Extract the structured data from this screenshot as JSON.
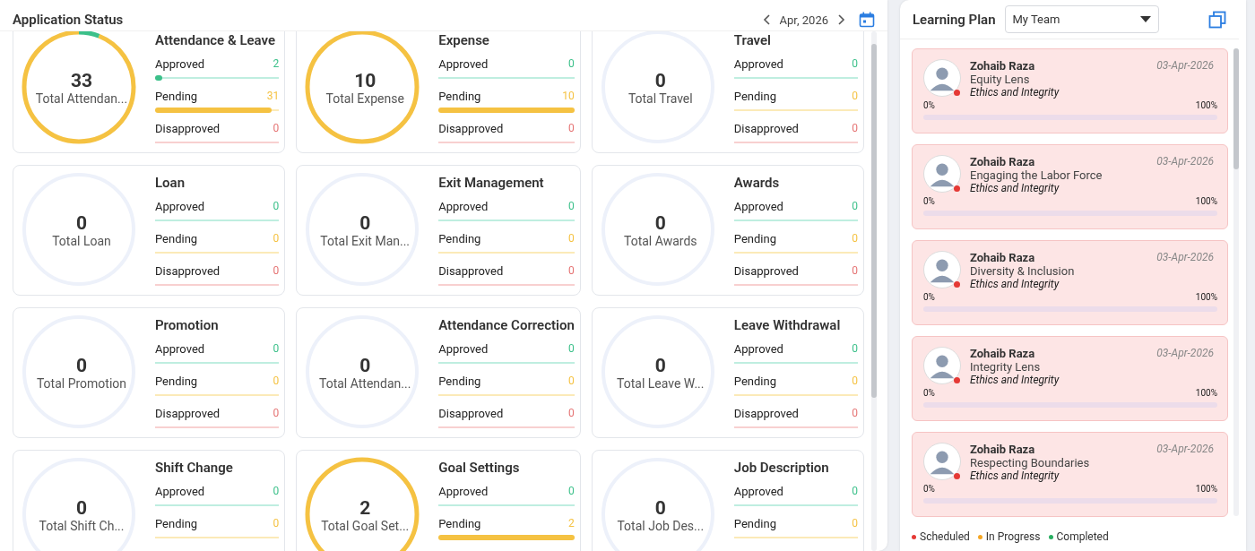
{
  "application_status": {
    "title": "Application Status",
    "period": "Apr, 2026",
    "cards": [
      {
        "title": "Attendance & Leave",
        "total": "33",
        "total_label": "Total Attendan...",
        "stats": [
          {
            "kind": "approved",
            "label": "Approved",
            "count": "2",
            "level": 0.06
          },
          {
            "kind": "pending",
            "label": "Pending",
            "count": "31",
            "level": 0.94
          },
          {
            "kind": "disapproved",
            "label": "Disapproved",
            "count": "0",
            "level": 0
          }
        ]
      },
      {
        "title": "Expense",
        "total": "10",
        "total_label": "Total Expense",
        "stats": [
          {
            "kind": "approved",
            "label": "Approved",
            "count": "0",
            "level": 0
          },
          {
            "kind": "pending",
            "label": "Pending",
            "count": "10",
            "level": 1
          },
          {
            "kind": "disapproved",
            "label": "Disapproved",
            "count": "0",
            "level": 0
          }
        ]
      },
      {
        "title": "Travel",
        "total": "0",
        "total_label": "Total Travel",
        "stats": [
          {
            "kind": "approved",
            "label": "Approved",
            "count": "0",
            "level": 0
          },
          {
            "kind": "pending",
            "label": "Pending",
            "count": "0",
            "level": 0
          },
          {
            "kind": "disapproved",
            "label": "Disapproved",
            "count": "0",
            "level": 0
          }
        ]
      },
      {
        "title": "Loan",
        "total": "0",
        "total_label": "Total Loan",
        "stats": [
          {
            "kind": "approved",
            "label": "Approved",
            "count": "0",
            "level": 0
          },
          {
            "kind": "pending",
            "label": "Pending",
            "count": "0",
            "level": 0
          },
          {
            "kind": "disapproved",
            "label": "Disapproved",
            "count": "0",
            "level": 0
          }
        ]
      },
      {
        "title": "Exit Management",
        "total": "0",
        "total_label": "Total Exit Man...",
        "stats": [
          {
            "kind": "approved",
            "label": "Approved",
            "count": "0",
            "level": 0
          },
          {
            "kind": "pending",
            "label": "Pending",
            "count": "0",
            "level": 0
          },
          {
            "kind": "disapproved",
            "label": "Disapproved",
            "count": "0",
            "level": 0
          }
        ]
      },
      {
        "title": "Awards",
        "total": "0",
        "total_label": "Total Awards",
        "stats": [
          {
            "kind": "approved",
            "label": "Approved",
            "count": "0",
            "level": 0
          },
          {
            "kind": "pending",
            "label": "Pending",
            "count": "0",
            "level": 0
          },
          {
            "kind": "disapproved",
            "label": "Disapproved",
            "count": "0",
            "level": 0
          }
        ]
      },
      {
        "title": "Promotion",
        "total": "0",
        "total_label": "Total Promotion",
        "stats": [
          {
            "kind": "approved",
            "label": "Approved",
            "count": "0",
            "level": 0
          },
          {
            "kind": "pending",
            "label": "Pending",
            "count": "0",
            "level": 0
          },
          {
            "kind": "disapproved",
            "label": "Disapproved",
            "count": "0",
            "level": 0
          }
        ]
      },
      {
        "title": "Attendance Correction",
        "total": "0",
        "total_label": "Total Attendan...",
        "stats": [
          {
            "kind": "approved",
            "label": "Approved",
            "count": "0",
            "level": 0
          },
          {
            "kind": "pending",
            "label": "Pending",
            "count": "0",
            "level": 0
          },
          {
            "kind": "disapproved",
            "label": "Disapproved",
            "count": "0",
            "level": 0
          }
        ]
      },
      {
        "title": "Leave Withdrawal",
        "total": "0",
        "total_label": "Total Leave W...",
        "stats": [
          {
            "kind": "approved",
            "label": "Approved",
            "count": "0",
            "level": 0
          },
          {
            "kind": "pending",
            "label": "Pending",
            "count": "0",
            "level": 0
          },
          {
            "kind": "disapproved",
            "label": "Disapproved",
            "count": "0",
            "level": 0
          }
        ]
      },
      {
        "title": "Shift Change",
        "total": "0",
        "total_label": "Total Shift Ch...",
        "stats": [
          {
            "kind": "approved",
            "label": "Approved",
            "count": "0",
            "level": 0
          },
          {
            "kind": "pending",
            "label": "Pending",
            "count": "0",
            "level": 0
          }
        ]
      },
      {
        "title": "Goal Settings",
        "total": "2",
        "total_label": "Total Goal Set...",
        "stats": [
          {
            "kind": "approved",
            "label": "Approved",
            "count": "0",
            "level": 0
          },
          {
            "kind": "pending",
            "label": "Pending",
            "count": "2",
            "level": 1
          }
        ]
      },
      {
        "title": "Job Description",
        "total": "0",
        "total_label": "Total Job Des...",
        "stats": [
          {
            "kind": "approved",
            "label": "Approved",
            "count": "0",
            "level": 0
          },
          {
            "kind": "pending",
            "label": "Pending",
            "count": "0",
            "level": 0
          }
        ]
      }
    ]
  },
  "learning_plan": {
    "title": "Learning Plan",
    "filter": "My Team",
    "items": [
      {
        "name": "Zohaib Raza",
        "course": "Equity Lens",
        "category": "Ethics and Integrity",
        "date": "03-Apr-2026",
        "min": "0%",
        "max": "100%",
        "level": 0,
        "color": "#e53935"
      },
      {
        "name": "Zohaib Raza",
        "course": "Engaging the Labor Force",
        "category": "Ethics and Integrity",
        "date": "03-Apr-2026",
        "min": "0%",
        "max": "100%",
        "level": 0,
        "color": "#e53935"
      },
      {
        "name": "Zohaib Raza",
        "course": "Diversity & Inclusion",
        "category": "Ethics and Integrity",
        "date": "03-Apr-2026",
        "min": "0%",
        "max": "100%",
        "level": 0,
        "color": "#e53935"
      },
      {
        "name": "Zohaib Raza",
        "course": "Integrity Lens",
        "category": "Ethics and Integrity",
        "date": "03-Apr-2026",
        "min": "0%",
        "max": "100%",
        "level": 0,
        "color": "#e53935"
      },
      {
        "name": "Zohaib Raza",
        "course": "Respecting Boundaries",
        "category": "Ethics and Integrity",
        "date": "03-Apr-2026",
        "min": "0%",
        "max": "100%",
        "level": 0,
        "color": "#e53935"
      }
    ],
    "legend": [
      {
        "label": "Scheduled",
        "color": "#e53935"
      },
      {
        "label": "In Progress",
        "color": "#f5a623"
      },
      {
        "label": "Completed",
        "color": "#27ae60"
      }
    ]
  }
}
